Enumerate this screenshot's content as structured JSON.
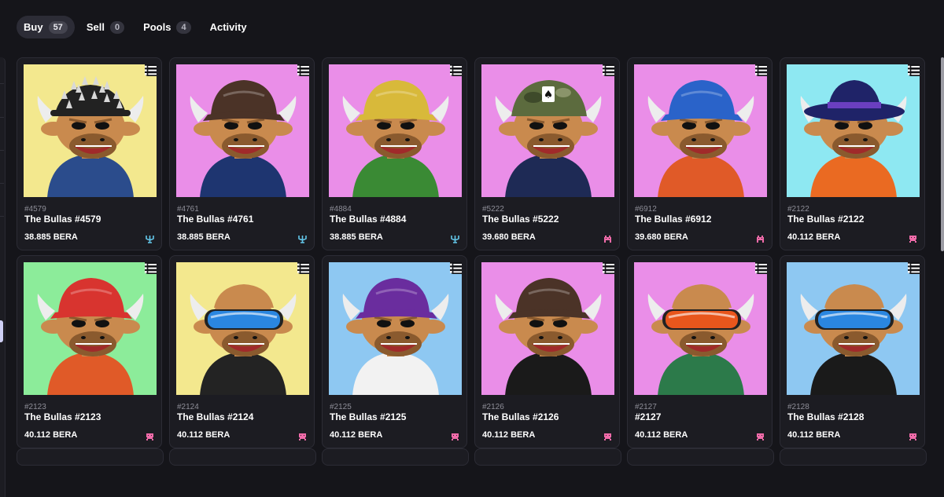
{
  "tabs": [
    {
      "label": "Buy",
      "count": "57",
      "active": true
    },
    {
      "label": "Sell",
      "count": "0",
      "active": false
    },
    {
      "label": "Pools",
      "count": "4",
      "active": false
    },
    {
      "label": "Activity",
      "count": null,
      "active": false
    }
  ],
  "cards": [
    {
      "id": "#4579",
      "name": "The Bullas #4579",
      "price": "38.885 BERA",
      "bg": "#f3e88e",
      "hat": "spiked",
      "hat_color": "#222222",
      "shirt": "#2b4c8c",
      "market": "trident-icon"
    },
    {
      "id": "#4761",
      "name": "The Bullas #4761",
      "price": "38.885 BERA",
      "bg": "#ea8ee8",
      "hat": "cap",
      "hat_color": "#4b3327",
      "shirt": "#1e3570",
      "market": "trident-icon"
    },
    {
      "id": "#4884",
      "name": "The Bullas #4884",
      "price": "38.885 BERA",
      "bg": "#ea8ee8",
      "hat": "cap",
      "hat_color": "#d8b93a",
      "shirt": "#3a8a34",
      "market": "trident-icon"
    },
    {
      "id": "#5222",
      "name": "The Bullas #5222",
      "price": "39.680 BERA",
      "bg": "#ea8ee8",
      "hat": "helmet",
      "hat_color": "#5c6b3e",
      "shirt": "#1e2a55",
      "market": "invader-icon"
    },
    {
      "id": "#6912",
      "name": "The Bullas #6912",
      "price": "39.680 BERA",
      "bg": "#ea8ee8",
      "hat": "cap",
      "hat_color": "#2a63c9",
      "shirt": "#e05a28",
      "market": "invader-icon"
    },
    {
      "id": "#2122",
      "name": "The Bullas #2122",
      "price": "40.112 BERA",
      "bg": "#8ee8f2",
      "hat": "fedora",
      "hat_color": "#1f2368",
      "shirt": "#ea6a22",
      "market": "pixel-icon"
    },
    {
      "id": "#2123",
      "name": "The Bullas #2123",
      "price": "40.112 BERA",
      "bg": "#8cec9a",
      "hat": "cap",
      "hat_color": "#d8342f",
      "shirt": "#e05a28",
      "market": "pixel-icon"
    },
    {
      "id": "#2124",
      "name": "The Bullas #2124",
      "price": "40.112 BERA",
      "bg": "#f3e88e",
      "hat": "goggles",
      "hat_color": "#2a86e0",
      "shirt": "#232323",
      "market": "pixel-icon"
    },
    {
      "id": "#2125",
      "name": "The Bullas #2125",
      "price": "40.112 BERA",
      "bg": "#8ec8f2",
      "hat": "cap",
      "hat_color": "#6a2d9e",
      "shirt": "#f2f2f2",
      "market": "pixel-icon"
    },
    {
      "id": "#2126",
      "name": "The Bullas #2126",
      "price": "40.112 BERA",
      "bg": "#ea8ee8",
      "hat": "cap",
      "hat_color": "#4b3327",
      "shirt": "#1a1a1a",
      "market": "pixel-icon"
    },
    {
      "id": "#2127",
      "name": "#2127",
      "price": "40.112 BERA",
      "bg": "#ea8ee8",
      "hat": "goggles",
      "hat_color": "#e8561c",
      "shirt": "#2c7a4a",
      "market": "pixel-icon"
    },
    {
      "id": "#2128",
      "name": "The Bullas #2128",
      "price": "40.112 BERA",
      "bg": "#8ec8f2",
      "hat": "goggles",
      "hat_color": "#2a86e0",
      "shirt": "#1a1a1a",
      "market": "pixel-icon"
    }
  ],
  "colors": {
    "trident": "#63c6e9",
    "marker": "#f06ba9",
    "bull": "#c98a4e",
    "bull_dark": "#8a5a2e"
  }
}
